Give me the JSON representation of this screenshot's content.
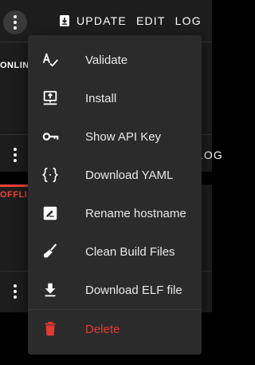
{
  "top_bar": {
    "actions": [
      {
        "label": "UPDATE",
        "icon": "update-icon"
      },
      {
        "label": "EDIT"
      },
      {
        "label": "LOG"
      }
    ]
  },
  "cards": [
    {
      "status": "ONLINE"
    },
    {
      "status": "OFFLINE"
    }
  ],
  "log_tail": "LOG",
  "menu": {
    "items": [
      {
        "label": "Validate",
        "icon": "validate-icon"
      },
      {
        "label": "Install",
        "icon": "install-icon"
      },
      {
        "label": "Show API Key",
        "icon": "key-icon"
      },
      {
        "label": "Download YAML",
        "icon": "code-braces-icon"
      },
      {
        "label": "Rename hostname",
        "icon": "rename-icon"
      },
      {
        "label": "Clean Build Files",
        "icon": "broom-icon"
      },
      {
        "label": "Download ELF file",
        "icon": "download-icon"
      },
      {
        "label": "Delete",
        "icon": "delete-icon"
      }
    ]
  },
  "colors": {
    "danger": "#e53935",
    "offline": "#f44336",
    "menu_bg": "#2b2b2b",
    "card_bg": "#1d1d1d"
  }
}
